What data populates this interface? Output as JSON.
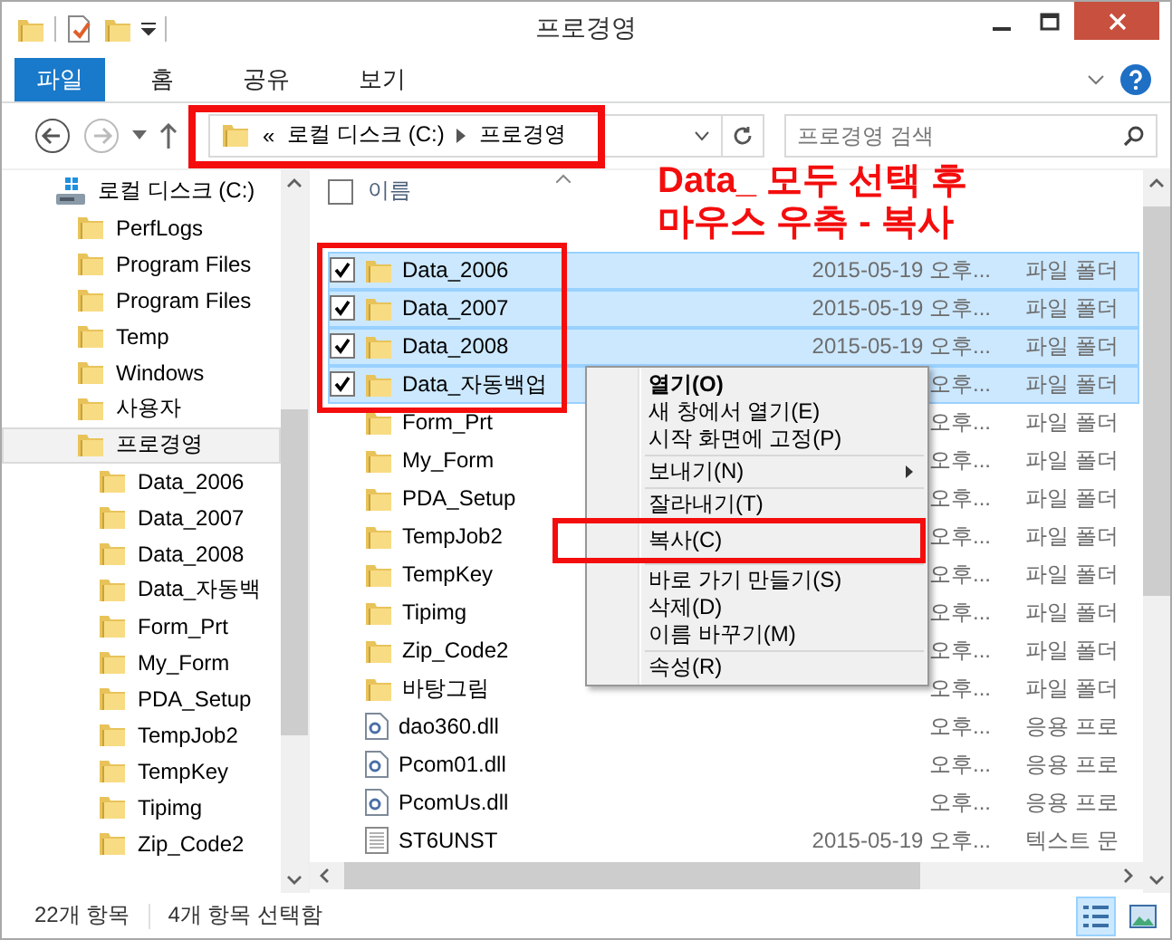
{
  "window": {
    "title": "프로경영"
  },
  "ribbon_tabs": [
    {
      "label": "파일",
      "selected": true
    },
    {
      "label": "홈",
      "selected": false
    },
    {
      "label": "공유",
      "selected": false
    },
    {
      "label": "보기",
      "selected": false
    }
  ],
  "address_bar": {
    "overflow": "«",
    "path": [
      "로컬 디스크 (C:)",
      "프로경영"
    ],
    "marked": true
  },
  "search": {
    "placeholder": "프로경영 검색"
  },
  "annotation_note": [
    "Data_ 모두 선택 후",
    "마우스 우측 - 복사"
  ],
  "nav_tree": [
    {
      "label": "로컬 디스크 (C:)",
      "kind": "drive",
      "selected": false,
      "children": [
        {
          "label": "PerfLogs",
          "kind": "folder",
          "selected": false
        },
        {
          "label": "Program Files",
          "kind": "folder",
          "selected": false
        },
        {
          "label": "Program Files",
          "kind": "folder",
          "selected": false
        },
        {
          "label": "Temp",
          "kind": "folder",
          "selected": false
        },
        {
          "label": "Windows",
          "kind": "folder",
          "selected": false
        },
        {
          "label": "사용자",
          "kind": "folder",
          "selected": false
        },
        {
          "label": "프로경영",
          "kind": "folder",
          "selected": true,
          "children": [
            {
              "label": "Data_2006",
              "kind": "folder",
              "selected": false
            },
            {
              "label": "Data_2007",
              "kind": "folder",
              "selected": false
            },
            {
              "label": "Data_2008",
              "kind": "folder",
              "selected": false
            },
            {
              "label": "Data_자동백",
              "kind": "folder",
              "selected": false
            },
            {
              "label": "Form_Prt",
              "kind": "folder",
              "selected": false
            },
            {
              "label": "My_Form",
              "kind": "folder",
              "selected": false
            },
            {
              "label": "PDA_Setup",
              "kind": "folder",
              "selected": false
            },
            {
              "label": "TempJob2",
              "kind": "folder",
              "selected": false
            },
            {
              "label": "TempKey",
              "kind": "folder",
              "selected": false
            },
            {
              "label": "Tipimg",
              "kind": "folder",
              "selected": false
            },
            {
              "label": "Zip_Code2",
              "kind": "folder",
              "selected": false
            }
          ]
        }
      ]
    }
  ],
  "file_list": {
    "columns": [
      "이름"
    ],
    "select_all_checked": false,
    "selection_framed": true,
    "rows": [
      {
        "name": "Data_2006",
        "kind": "folder",
        "date": "2015-05-19 오후...",
        "type": "파일 폴더",
        "selected": true
      },
      {
        "name": "Data_2007",
        "kind": "folder",
        "date": "2015-05-19 오후...",
        "type": "파일 폴더",
        "selected": true
      },
      {
        "name": "Data_2008",
        "kind": "folder",
        "date": "2015-05-19 오후...",
        "type": "파일 폴더",
        "selected": true
      },
      {
        "name": "Data_자동백업",
        "kind": "folder",
        "date": "오후...",
        "type": "파일 폴더",
        "selected": true
      },
      {
        "name": "Form_Prt",
        "kind": "folder",
        "date": "오후...",
        "type": "파일 폴더",
        "selected": false
      },
      {
        "name": "My_Form",
        "kind": "folder",
        "date": "오후...",
        "type": "파일 폴더",
        "selected": false
      },
      {
        "name": "PDA_Setup",
        "kind": "folder",
        "date": "오후...",
        "type": "파일 폴더",
        "selected": false
      },
      {
        "name": "TempJob2",
        "kind": "folder",
        "date": "오후...",
        "type": "파일 폴더",
        "selected": false
      },
      {
        "name": "TempKey",
        "kind": "folder",
        "date": "오후...",
        "type": "파일 폴더",
        "selected": false
      },
      {
        "name": "Tipimg",
        "kind": "folder",
        "date": "오후...",
        "type": "파일 폴더",
        "selected": false
      },
      {
        "name": "Zip_Code2",
        "kind": "folder",
        "date": "오후...",
        "type": "파일 폴더",
        "selected": false
      },
      {
        "name": "바탕그림",
        "kind": "folder",
        "date": "오후...",
        "type": "파일 폴더",
        "selected": false
      },
      {
        "name": "dao360.dll",
        "kind": "dll",
        "date": "오후...",
        "type": "응용 프로",
        "selected": false
      },
      {
        "name": "Pcom01.dll",
        "kind": "dll",
        "date": "오후...",
        "type": "응용 프로",
        "selected": false
      },
      {
        "name": "PcomUs.dll",
        "kind": "dll",
        "date": "오후...",
        "type": "응용 프로",
        "selected": false
      },
      {
        "name": "ST6UNST",
        "kind": "text",
        "date": "2015-05-19 오후...",
        "type": "텍스트 문",
        "selected": false
      }
    ]
  },
  "context_menu": {
    "groups": [
      [
        {
          "label": "열기(O)",
          "default": true,
          "submenu": false,
          "marked": false
        },
        {
          "label": "새 창에서 열기(E)",
          "default": false,
          "submenu": false,
          "marked": false
        },
        {
          "label": "시작 화면에 고정(P)",
          "default": false,
          "submenu": false,
          "marked": false
        }
      ],
      [
        {
          "label": "보내기(N)",
          "default": false,
          "submenu": true,
          "marked": false
        }
      ],
      [
        {
          "label": "잘라내기(T)",
          "default": false,
          "submenu": false,
          "marked": false
        },
        {
          "label": "복사(C)",
          "default": false,
          "submenu": false,
          "marked": true
        }
      ],
      [
        {
          "label": "바로 가기 만들기(S)",
          "default": false,
          "submenu": false,
          "marked": false
        },
        {
          "label": "삭제(D)",
          "default": false,
          "submenu": false,
          "marked": false
        },
        {
          "label": "이름 바꾸기(M)",
          "default": false,
          "submenu": false,
          "marked": false
        }
      ],
      [
        {
          "label": "속성(R)",
          "default": false,
          "submenu": false,
          "marked": false
        }
      ]
    ]
  },
  "status_bar": {
    "item_count": "22개 항목",
    "selection": "4개 항목 선택함",
    "views": [
      {
        "kind": "details",
        "selected": true
      },
      {
        "kind": "large-icons",
        "selected": false
      }
    ]
  }
}
